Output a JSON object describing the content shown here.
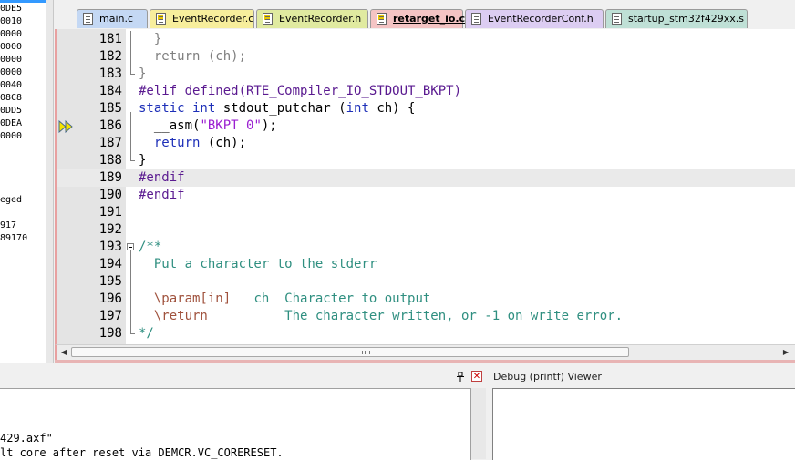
{
  "registers": [
    "0DE5",
    "0010",
    "0000",
    "0000",
    "0000",
    "0000",
    "0040",
    "08C8",
    "0DD5",
    "0DEA",
    "0000",
    "eged",
    "917",
    "89170"
  ],
  "tabs": [
    {
      "label": "main.c",
      "color": "#c4d8f4",
      "modified": false,
      "active": false
    },
    {
      "label": "EventRecorder.c",
      "color": "#f7ee9c",
      "modified": true,
      "active": false
    },
    {
      "label": "EventRecorder.h",
      "color": "#e0eaa0",
      "modified": true,
      "active": false
    },
    {
      "label": "retarget_io.c",
      "color": "#f4c4c4",
      "modified": true,
      "active": true
    },
    {
      "label": "EventRecorderConf.h",
      "color": "#dccdf2",
      "modified": false,
      "active": false
    },
    {
      "label": "startup_stm32f429xx.s",
      "color": "#bfe0d6",
      "modified": false,
      "active": false
    }
  ],
  "code_lines": [
    {
      "num": "181",
      "segments": [
        {
          "t": "  }",
          "c": "grey"
        }
      ]
    },
    {
      "num": "182",
      "segments": [
        {
          "t": "  return (ch);",
          "c": "grey"
        }
      ]
    },
    {
      "num": "183",
      "segments": [
        {
          "t": "}",
          "c": "grey"
        }
      ]
    },
    {
      "num": "184",
      "segments": [
        {
          "t": "#elif defined(RTE_Compiler_IO_STDOUT_BKPT)",
          "c": "pp"
        }
      ]
    },
    {
      "num": "185",
      "segments": [
        {
          "t": "static int",
          "c": "kw"
        },
        {
          "t": " stdout_putchar (",
          "c": "pl"
        },
        {
          "t": "int",
          "c": "kw"
        },
        {
          "t": " ch) {",
          "c": "pl"
        }
      ]
    },
    {
      "num": "186",
      "segments": [
        {
          "t": "  __asm(",
          "c": "pl"
        },
        {
          "t": "\"BKPT 0\"",
          "c": "str"
        },
        {
          "t": ");",
          "c": "pl"
        }
      ]
    },
    {
      "num": "187",
      "segments": [
        {
          "t": "  ",
          "c": "pl"
        },
        {
          "t": "return",
          "c": "kw"
        },
        {
          "t": " (ch);",
          "c": "pl"
        }
      ]
    },
    {
      "num": "188",
      "segments": [
        {
          "t": "}",
          "c": "pl"
        }
      ]
    },
    {
      "num": "189",
      "segments": [
        {
          "t": "#endif",
          "c": "pp"
        }
      ]
    },
    {
      "num": "190",
      "segments": [
        {
          "t": "#endif",
          "c": "pp"
        }
      ]
    },
    {
      "num": "191",
      "segments": []
    },
    {
      "num": "192",
      "segments": []
    },
    {
      "num": "193",
      "segments": [
        {
          "t": "/**",
          "c": "cm"
        }
      ]
    },
    {
      "num": "194",
      "segments": [
        {
          "t": "  Put a character to the stderr",
          "c": "cm"
        }
      ]
    },
    {
      "num": "195",
      "segments": []
    },
    {
      "num": "196",
      "segments": [
        {
          "t": "  \\param[in]",
          "c": "tag"
        },
        {
          "t": "   ch  Character to output",
          "c": "cm"
        }
      ]
    },
    {
      "num": "197",
      "segments": [
        {
          "t": "  \\return",
          "c": "tag"
        },
        {
          "t": "          The character written, or -1 on write error.",
          "c": "cm"
        }
      ]
    },
    {
      "num": "198",
      "segments": [
        {
          "t": "*/",
          "c": "cm"
        }
      ]
    }
  ],
  "output": {
    "line1": "429.axf\"",
    "line2": "lt core after reset via DEMCR.VC_CORERESET."
  },
  "debug_viewer": {
    "title": "Debug (printf) Viewer"
  },
  "icons": {
    "pin": "pin-icon",
    "close": "close-icon",
    "arrow": "current-line-arrow-icon"
  }
}
